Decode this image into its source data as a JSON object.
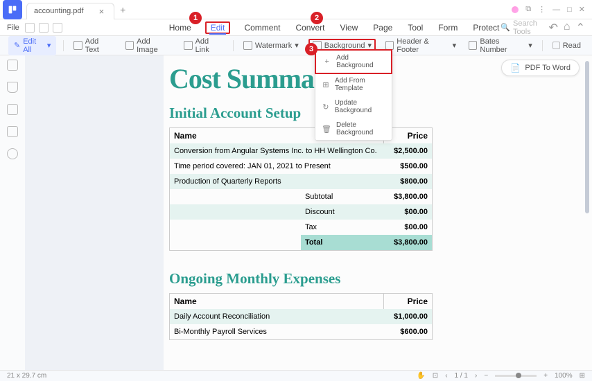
{
  "titlebar": {
    "filename": "accounting.pdf"
  },
  "menubar": {
    "file": "File",
    "tabs": [
      "Home",
      "Edit",
      "Comment",
      "Convert",
      "View",
      "Page",
      "Tool",
      "Form",
      "Protect"
    ],
    "active_tab": "Edit",
    "search_placeholder": "Search Tools"
  },
  "toolbar": {
    "edit_all": "Edit All",
    "add_text": "Add Text",
    "add_image": "Add Image",
    "add_link": "Add Link",
    "watermark": "Watermark",
    "background": "Background",
    "header_footer": "Header & Footer",
    "bates": "Bates Number",
    "read": "Read"
  },
  "dropdown": {
    "items": [
      {
        "icon": "+",
        "label": "Add Background"
      },
      {
        "icon": "⊞",
        "label": "Add From Template"
      },
      {
        "icon": "↻",
        "label": "Update Background"
      },
      {
        "icon": "🗑",
        "label": "Delete Background"
      }
    ]
  },
  "right_float": "PDF To Word",
  "doc": {
    "title": "Cost Summa",
    "section1": {
      "heading": "Initial Account Setup",
      "cols": [
        "Name",
        "Price"
      ],
      "rows": [
        {
          "name": "Conversion from Angular Systems Inc. to HH Wellington Co.",
          "price": "$2,500.00"
        },
        {
          "name": "Time period covered: JAN 01, 2021 to Present",
          "price": "$500.00"
        },
        {
          "name": "Production of Quarterly Reports",
          "price": "$800.00"
        }
      ],
      "summary": [
        {
          "label": "Subtotal",
          "value": "$3,800.00"
        },
        {
          "label": "Discount",
          "value": "$00.00"
        },
        {
          "label": "Tax",
          "value": "$00.00"
        },
        {
          "label": "Total",
          "value": "$3,800.00"
        }
      ]
    },
    "section2": {
      "heading": "Ongoing Monthly Expenses",
      "cols": [
        "Name",
        "Price"
      ],
      "rows": [
        {
          "name": "Daily Account Reconciliation",
          "price": "$1,000.00"
        },
        {
          "name": "Bi-Monthly Payroll Services",
          "price": "$600.00"
        }
      ]
    }
  },
  "status": {
    "dims": "21 x 29.7 cm",
    "page": "1 / 1",
    "zoom": "100%"
  },
  "badges": [
    "1",
    "2",
    "3"
  ]
}
